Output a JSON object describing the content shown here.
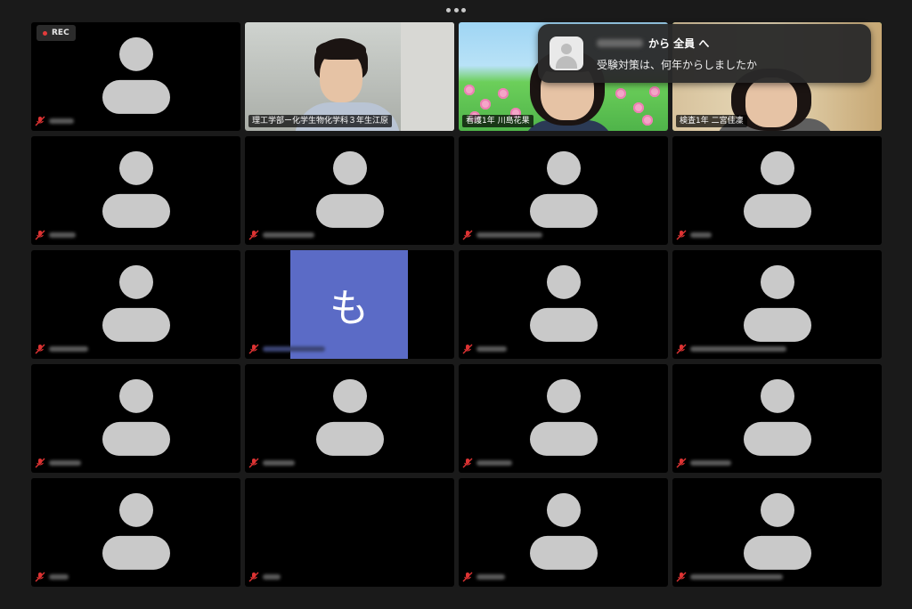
{
  "toolbar": {
    "more_icon": "ellipsis-icon"
  },
  "recording": {
    "label": "REC",
    "color": "#e23b3b"
  },
  "chat_toast": {
    "from_suffix": "から 全員 へ",
    "message": "受験対策は、何年からしましたか"
  },
  "active_speaker_color": "#3fd84a",
  "tiles": [
    {
      "type": "avatar",
      "muted": true
    },
    {
      "type": "video",
      "label": "理工学部ー化学生物化学科３年生江原"
    },
    {
      "type": "video",
      "label": "看護1年 川島花果"
    },
    {
      "type": "video",
      "label": "検査1年 二宮佳凜",
      "active": true
    },
    {
      "type": "avatar",
      "muted": true
    },
    {
      "type": "avatar",
      "muted": true
    },
    {
      "type": "avatar",
      "muted": true
    },
    {
      "type": "avatar",
      "muted": true
    },
    {
      "type": "avatar",
      "muted": true
    },
    {
      "type": "initial",
      "initial": "も",
      "muted": true,
      "color": "#5b6bc6"
    },
    {
      "type": "avatar",
      "muted": true
    },
    {
      "type": "avatar",
      "muted": true
    },
    {
      "type": "avatar",
      "muted": true
    },
    {
      "type": "avatar",
      "muted": true
    },
    {
      "type": "avatar",
      "muted": true
    },
    {
      "type": "avatar",
      "muted": true
    },
    {
      "type": "avatar",
      "muted": true
    },
    {
      "type": "blank",
      "muted": true
    },
    {
      "type": "avatar",
      "muted": true
    },
    {
      "type": "avatar",
      "muted": true
    }
  ]
}
